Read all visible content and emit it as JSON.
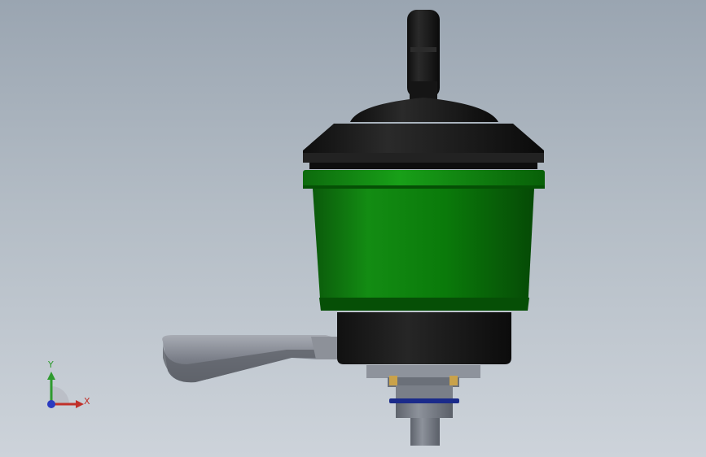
{
  "viewport": {
    "background_top": "#9aa5b1",
    "background_bottom": "#cdd3da"
  },
  "model": {
    "body_color": "#0a7a0a",
    "cap_color": "#1a1a1a",
    "lever_color": "#8a8e96",
    "ring_color": "#1a2a8a",
    "shaft_color": "#7a808a"
  },
  "triad": {
    "x_label": "X",
    "y_label": "Y",
    "x_color": "#c0302a",
    "y_color": "#2e9a2e",
    "z_color": "#2a3ac0"
  }
}
